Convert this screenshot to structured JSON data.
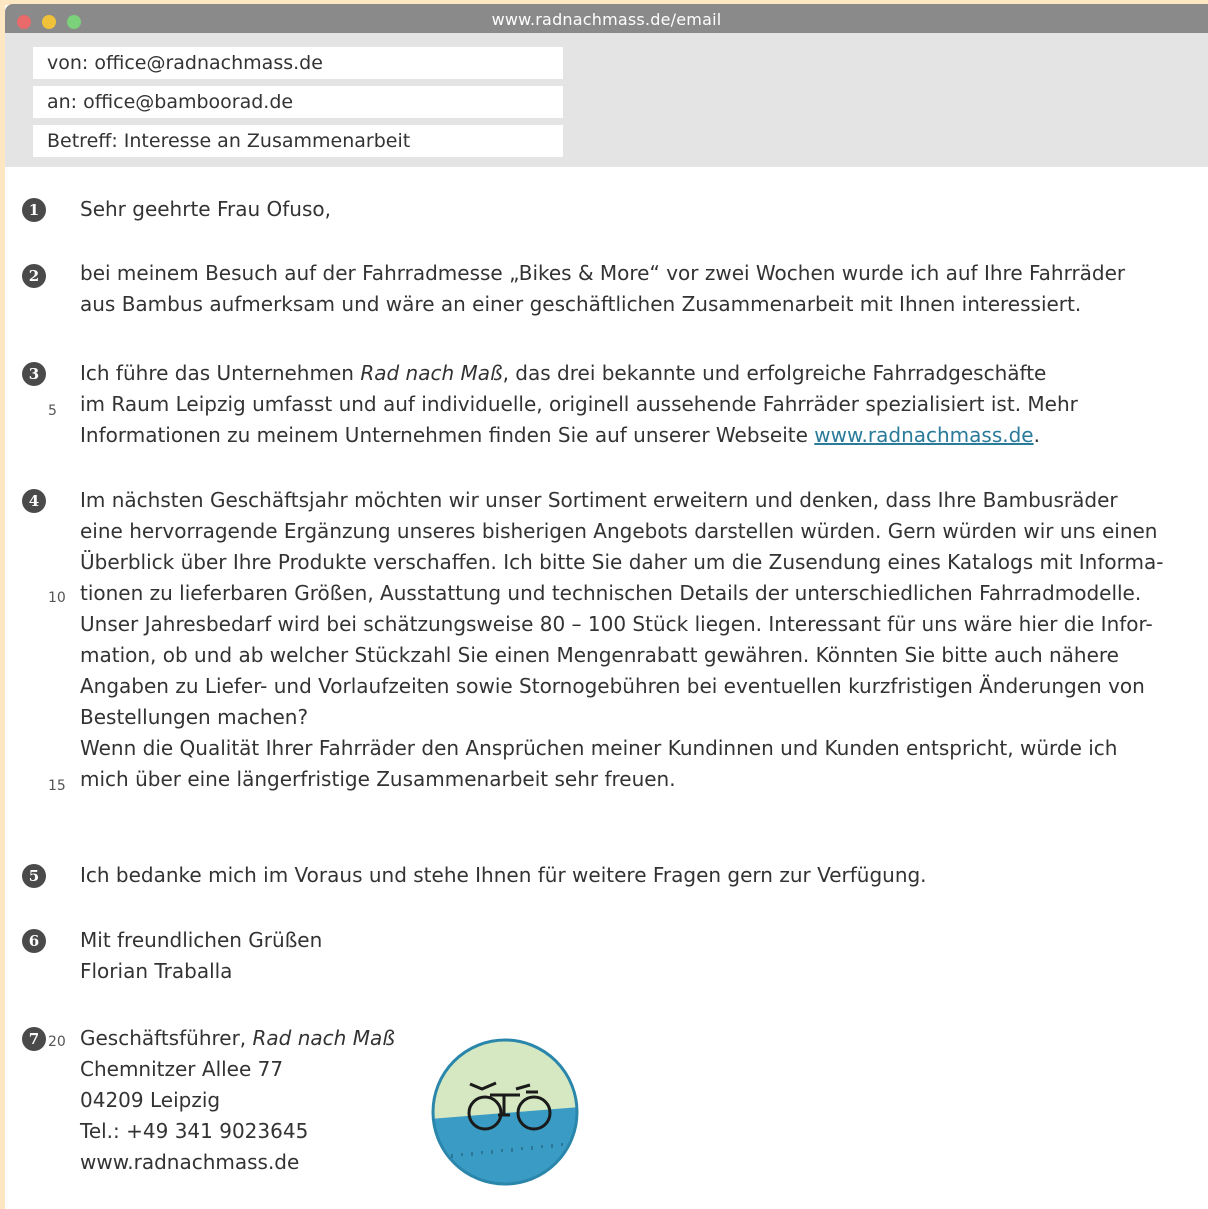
{
  "window": {
    "url": "www.radnachmass.de/email"
  },
  "email": {
    "from": "von: office@radnachmass.de",
    "to": "an: office@bamboorad.de",
    "subject": "Betreff: Interesse an Zusammenarbeit"
  },
  "paragraph_numbers": [
    "1",
    "2",
    "3",
    "4",
    "5",
    "6",
    "7"
  ],
  "line_numbers": [
    "5",
    "10",
    "15",
    "20"
  ],
  "body": {
    "p1": "Sehr geehrte Frau Ofuso,",
    "p2_l1": "bei meinem Besuch auf der Fahrradmesse „Bikes & More“ vor zwei Wochen wurde ich auf Ihre Fahrräder",
    "p2_l2": "aus Bambus aufmerksam und wäre an einer geschäftlichen Zusammenarbeit mit Ihnen interessiert.",
    "p3_l1_a": "Ich führe das Unternehmen ",
    "p3_company": "Rad nach Maß",
    "p3_l1_b": ", das drei bekannte und erfolgreiche Fahrradgeschäfte",
    "p3_l2": "im Raum Leipzig umfasst und auf individuelle, originell aussehende Fahrräder spezialisiert ist. Mehr",
    "p3_l3_a": "Informationen zu meinem Unternehmen finden Sie auf unserer Webseite ",
    "p3_link": "www.radnachmass.de",
    "p3_l3_b": ".",
    "p4_l1": "Im nächsten Geschäftsjahr möchten wir unser Sortiment erweitern und denken, dass Ihre Bambusräder",
    "p4_l2": "eine hervorragende Ergänzung unseres bisherigen Angebots darstellen würden. Gern würden wir uns einen",
    "p4_l3": "Überblick über Ihre Produkte verschaffen. Ich bitte Sie daher um die Zusendung eines Katalogs mit Informa-",
    "p4_l4": "tionen zu lieferbaren Größen, Ausstattung und technischen Details der unterschiedlichen Fahrradmodelle.",
    "p4_l5": "Unser Jahresbedarf wird bei schätzungsweise 80 – 100 Stück liegen. Interessant für uns wäre hier die Infor-",
    "p4_l6": "mation, ob und ab welcher Stückzahl Sie einen Mengenrabatt gewähren. Könnten Sie bitte auch nähere",
    "p4_l7": "Angaben zu Liefer- und Vorlaufzeiten sowie Stornogebühren bei eventuellen kurzfristigen Änderungen von",
    "p4_l8": "Bestellungen machen?",
    "p4_l9": "Wenn die Qualität Ihrer Fahrräder den Ansprüchen meiner Kundinnen und Kunden entspricht, würde ich",
    "p4_l10": "mich über eine längerfristige Zusammenarbeit sehr freuen.",
    "p5": "Ich bedanke mich im Voraus und stehe Ihnen für weitere Fragen gern zur Verfügung.",
    "p6_l1": "Mit freundlichen Grüßen",
    "p6_l2": "Florian Traballa",
    "sig_title": "Geschäftsführer, ",
    "sig_company": "Rad nach Maß",
    "sig_street": "Chemnitzer Allee 77",
    "sig_city": "04209 Leipzig",
    "sig_phone": "Tel.: +49 341 9023645",
    "sig_web": "www.radnachmass.de"
  },
  "colors": {
    "titlebar": "#8a8a8a",
    "header_bg": "#e4e4e4",
    "link": "#2a7a9a",
    "logo_green": "#d6e8c2",
    "logo_blue": "#3a9cc4",
    "logo_border": "#2a86aa"
  }
}
